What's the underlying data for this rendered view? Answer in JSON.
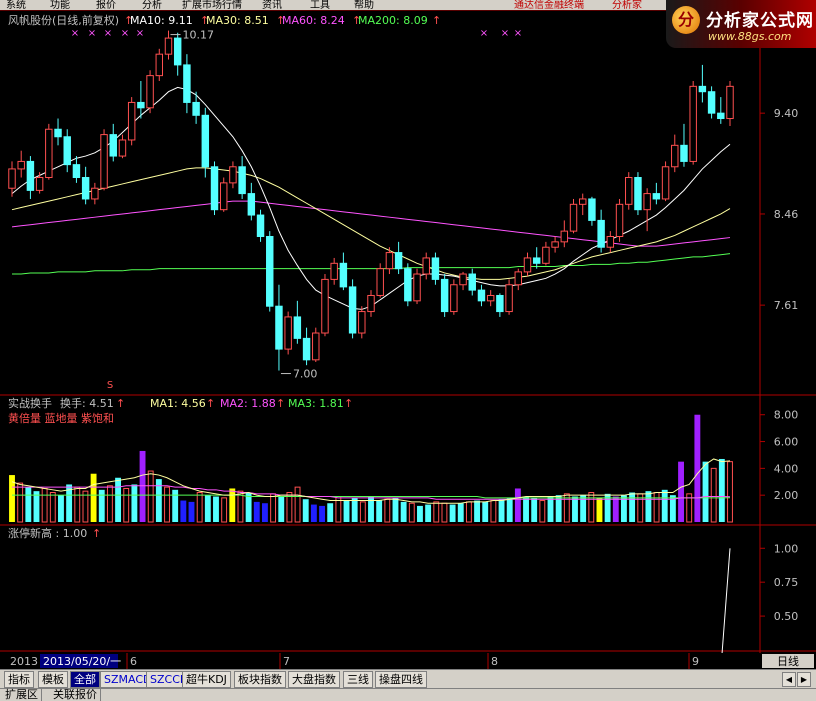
{
  "menu": {
    "items": [
      "系统",
      "功能",
      "报价",
      "分析",
      "扩展市场行情",
      "资讯",
      "工具",
      "帮助"
    ],
    "marquee": "通达信金融终端",
    "marquee2": "分析家"
  },
  "logo": {
    "name": "分析家公式网",
    "url": "www.88gs.com"
  },
  "main_header": {
    "stock": "风帆股份(日线,前复权)",
    "ma10": "MA10: 9.11",
    "ma30": "MA30: 8.51",
    "ma60": "MA60: 8.24",
    "ma200": "MA200: 8.09"
  },
  "turnover_header": {
    "name": "实战换手",
    "value": "换手: 4.51",
    "ma1": "MA1: 4.56",
    "ma2": "MA2: 1.88",
    "ma3": "MA3: 1.81",
    "legend": "黄倍量 蓝地量 紫饱和"
  },
  "limit_header": {
    "label": "涨停新高 : 1.00"
  },
  "annotations": {
    "high": "10.17",
    "low": "7.00",
    "marker": "S"
  },
  "date_axis": {
    "year": "2013",
    "cursor": "2013/05/20/一",
    "months": [
      "6",
      "7",
      "8",
      "9"
    ],
    "period": "日线"
  },
  "tabs": [
    "指标",
    "模板",
    "全部",
    "SZMACD",
    "SZCCI",
    "超牛KDJ",
    "板块指数",
    "大盘指数",
    "三线",
    "操盘四线"
  ],
  "status_tabs": [
    "扩展区",
    "关联报价"
  ],
  "colors": {
    "up": "#ff5050",
    "down": "#54ffff",
    "ma10": "#ffffff",
    "ma30": "#ffffa0",
    "ma60": "#ff54ff",
    "ma200": "#54ff54",
    "axis": "#b00000",
    "vol_yellow": "#ffff00",
    "vol_blue": "#2020ff",
    "vol_purple": "#a020ff"
  },
  "chart_data": [
    {
      "type": "candlestick",
      "ylim": [
        6.8,
        10.25
      ],
      "yticks": [
        7.61,
        8.46,
        9.4
      ],
      "ohlc": [
        [
          8.7,
          8.95,
          8.62,
          8.88
        ],
        [
          8.88,
          9.05,
          8.8,
          8.95
        ],
        [
          8.95,
          9.0,
          8.6,
          8.68
        ],
        [
          8.68,
          8.85,
          8.65,
          8.8
        ],
        [
          8.8,
          9.3,
          8.78,
          9.25
        ],
        [
          9.25,
          9.35,
          9.1,
          9.18
        ],
        [
          9.18,
          9.25,
          8.85,
          8.92
        ],
        [
          8.92,
          9.0,
          8.75,
          8.8
        ],
        [
          8.8,
          8.9,
          8.55,
          8.6
        ],
        [
          8.6,
          8.75,
          8.55,
          8.7
        ],
        [
          8.7,
          9.25,
          8.68,
          9.2
        ],
        [
          9.2,
          9.3,
          8.95,
          9.0
        ],
        [
          9.0,
          9.2,
          8.98,
          9.15
        ],
        [
          9.15,
          9.55,
          9.1,
          9.5
        ],
        [
          9.5,
          9.7,
          9.35,
          9.45
        ],
        [
          9.45,
          9.8,
          9.4,
          9.75
        ],
        [
          9.75,
          10.0,
          9.7,
          9.95
        ],
        [
          9.95,
          10.17,
          9.9,
          10.1
        ],
        [
          10.1,
          10.15,
          9.75,
          9.85
        ],
        [
          9.85,
          9.95,
          9.4,
          9.5
        ],
        [
          9.5,
          9.6,
          9.3,
          9.38
        ],
        [
          9.38,
          9.45,
          8.8,
          8.9
        ],
        [
          8.9,
          8.95,
          8.45,
          8.5
        ],
        [
          8.5,
          8.8,
          8.48,
          8.75
        ],
        [
          8.75,
          8.95,
          8.7,
          8.9
        ],
        [
          8.9,
          9.0,
          8.6,
          8.65
        ],
        [
          8.65,
          8.75,
          8.4,
          8.45
        ],
        [
          8.45,
          8.5,
          8.2,
          8.25
        ],
        [
          8.25,
          8.3,
          7.55,
          7.6
        ],
        [
          7.6,
          7.8,
          7.0,
          7.2
        ],
        [
          7.2,
          7.55,
          7.15,
          7.5
        ],
        [
          7.5,
          7.65,
          7.25,
          7.3
        ],
        [
          7.3,
          7.4,
          7.05,
          7.1
        ],
        [
          7.1,
          7.4,
          7.08,
          7.35
        ],
        [
          7.35,
          7.9,
          7.32,
          7.85
        ],
        [
          7.85,
          8.05,
          7.8,
          8.0
        ],
        [
          8.0,
          8.1,
          7.75,
          7.78
        ],
        [
          7.78,
          7.85,
          7.3,
          7.35
        ],
        [
          7.35,
          7.6,
          7.3,
          7.55
        ],
        [
          7.55,
          7.75,
          7.5,
          7.7
        ],
        [
          7.7,
          8.0,
          7.68,
          7.95
        ],
        [
          7.95,
          8.15,
          7.9,
          8.1
        ],
        [
          8.1,
          8.2,
          7.9,
          7.95
        ],
        [
          7.95,
          8.0,
          7.6,
          7.65
        ],
        [
          7.65,
          7.95,
          7.62,
          7.9
        ],
        [
          7.9,
          8.1,
          7.85,
          8.05
        ],
        [
          8.05,
          8.1,
          7.8,
          7.85
        ],
        [
          7.85,
          7.9,
          7.5,
          7.55
        ],
        [
          7.55,
          7.85,
          7.52,
          7.8
        ],
        [
          7.8,
          7.92,
          7.75,
          7.9
        ],
        [
          7.9,
          7.95,
          7.7,
          7.75
        ],
        [
          7.75,
          7.8,
          7.6,
          7.65
        ],
        [
          7.65,
          7.75,
          7.6,
          7.7
        ],
        [
          7.7,
          7.72,
          7.5,
          7.55
        ],
        [
          7.55,
          7.85,
          7.52,
          7.8
        ],
        [
          7.8,
          7.95,
          7.75,
          7.92
        ],
        [
          7.92,
          8.1,
          7.88,
          8.05
        ],
        [
          8.05,
          8.15,
          7.95,
          8.0
        ],
        [
          8.0,
          8.2,
          7.98,
          8.15
        ],
        [
          8.15,
          8.25,
          8.1,
          8.2
        ],
        [
          8.2,
          8.4,
          8.15,
          8.3
        ],
        [
          8.3,
          8.6,
          8.28,
          8.55
        ],
        [
          8.55,
          8.65,
          8.45,
          8.6
        ],
        [
          8.6,
          8.62,
          8.35,
          8.4
        ],
        [
          8.4,
          8.5,
          8.1,
          8.15
        ],
        [
          8.15,
          8.3,
          8.1,
          8.25
        ],
        [
          8.25,
          8.6,
          8.2,
          8.55
        ],
        [
          8.55,
          8.85,
          8.5,
          8.8
        ],
        [
          8.8,
          8.85,
          8.45,
          8.5
        ],
        [
          8.5,
          8.7,
          8.3,
          8.65
        ],
        [
          8.65,
          8.75,
          8.55,
          8.6
        ],
        [
          8.6,
          8.95,
          8.58,
          8.9
        ],
        [
          8.9,
          9.2,
          8.85,
          9.1
        ],
        [
          9.1,
          9.3,
          8.9,
          8.95
        ],
        [
          8.95,
          9.7,
          8.92,
          9.65
        ],
        [
          9.65,
          9.85,
          9.5,
          9.6
        ],
        [
          9.6,
          9.65,
          9.35,
          9.4
        ],
        [
          9.4,
          9.55,
          9.3,
          9.35
        ],
        [
          9.35,
          9.7,
          9.28,
          9.65
        ]
      ],
      "ma10": [
        8.65,
        8.72,
        8.78,
        8.82,
        8.86,
        8.9,
        8.94,
        8.98,
        9.0,
        9.03,
        9.08,
        9.14,
        9.22,
        9.3,
        9.38,
        9.45,
        9.52,
        9.6,
        9.64,
        9.62,
        9.57,
        9.48,
        9.38,
        9.28,
        9.18,
        9.05,
        8.9,
        8.72,
        8.52,
        8.3,
        8.12,
        7.98,
        7.85,
        7.75,
        7.7,
        7.66,
        7.62,
        7.58,
        7.57,
        7.6,
        7.66,
        7.72,
        7.78,
        7.84,
        7.88,
        7.9,
        7.9,
        7.89,
        7.88,
        7.86,
        7.84,
        7.82,
        7.8,
        7.79,
        7.79,
        7.8,
        7.82,
        7.84,
        7.86,
        7.9,
        7.95,
        8.02,
        8.08,
        8.14,
        8.18,
        8.22,
        8.26,
        8.3,
        8.35,
        8.4,
        8.45,
        8.52,
        8.6,
        8.68,
        8.78,
        8.88,
        8.96,
        9.04,
        9.11
      ],
      "ma30": [
        8.5,
        8.52,
        8.54,
        8.56,
        8.58,
        8.6,
        8.62,
        8.64,
        8.66,
        8.68,
        8.7,
        8.72,
        8.74,
        8.76,
        8.78,
        8.8,
        8.82,
        8.84,
        8.86,
        8.88,
        8.89,
        8.89,
        8.88,
        8.87,
        8.86,
        8.84,
        8.82,
        8.79,
        8.75,
        8.71,
        8.66,
        8.61,
        8.56,
        8.51,
        8.46,
        8.41,
        8.36,
        8.31,
        8.26,
        8.21,
        8.16,
        8.12,
        8.08,
        8.04,
        8.0,
        7.97,
        7.94,
        7.91,
        7.89,
        7.87,
        7.86,
        7.85,
        7.85,
        7.85,
        7.86,
        7.87,
        7.88,
        7.9,
        7.92,
        7.94,
        7.97,
        8.0,
        8.03,
        8.06,
        8.08,
        8.1,
        8.12,
        8.14,
        8.16,
        8.18,
        8.2,
        8.23,
        8.26,
        8.3,
        8.34,
        8.38,
        8.42,
        8.46,
        8.51
      ],
      "ma60": [
        8.34,
        8.35,
        8.36,
        8.37,
        8.38,
        8.39,
        8.4,
        8.41,
        8.42,
        8.43,
        8.44,
        8.45,
        8.46,
        8.47,
        8.48,
        8.49,
        8.5,
        8.51,
        8.52,
        8.53,
        8.54,
        8.55,
        8.56,
        8.57,
        8.58,
        8.58,
        8.58,
        8.57,
        8.56,
        8.55,
        8.54,
        8.53,
        8.52,
        8.51,
        8.5,
        8.49,
        8.48,
        8.47,
        8.46,
        8.45,
        8.44,
        8.43,
        8.42,
        8.41,
        8.4,
        8.39,
        8.38,
        8.37,
        8.36,
        8.35,
        8.34,
        8.33,
        8.32,
        8.31,
        8.3,
        8.29,
        8.28,
        8.27,
        8.26,
        8.25,
        8.24,
        8.23,
        8.22,
        8.21,
        8.2,
        8.19,
        8.18,
        8.17,
        8.16,
        8.16,
        8.16,
        8.17,
        8.18,
        8.19,
        8.2,
        8.21,
        8.22,
        8.23,
        8.24
      ],
      "ma200": [
        7.9,
        7.9,
        7.91,
        7.91,
        7.91,
        7.92,
        7.92,
        7.92,
        7.92,
        7.93,
        7.93,
        7.93,
        7.93,
        7.94,
        7.94,
        7.94,
        7.95,
        7.95,
        7.95,
        7.95,
        7.95,
        7.95,
        7.95,
        7.95,
        7.95,
        7.95,
        7.95,
        7.95,
        7.95,
        7.95,
        7.95,
        7.95,
        7.95,
        7.95,
        7.95,
        7.95,
        7.95,
        7.95,
        7.95,
        7.95,
        7.95,
        7.95,
        7.95,
        7.96,
        7.96,
        7.96,
        7.96,
        7.96,
        7.96,
        7.96,
        7.96,
        7.96,
        7.96,
        7.96,
        7.96,
        7.97,
        7.97,
        7.97,
        7.97,
        7.97,
        7.98,
        7.98,
        7.98,
        7.99,
        7.99,
        7.99,
        8.0,
        8.0,
        8.01,
        8.01,
        8.02,
        8.03,
        8.04,
        8.05,
        8.06,
        8.06,
        8.07,
        8.08,
        8.09
      ]
    },
    {
      "type": "bar",
      "ylim": [
        0,
        8.8
      ],
      "yticks": [
        2.0,
        4.0,
        6.0,
        8.0
      ],
      "values": [
        3.5,
        2.9,
        2.6,
        2.3,
        2.5,
        2.2,
        2.0,
        2.8,
        2.6,
        2.3,
        3.6,
        2.4,
        2.7,
        3.3,
        2.5,
        2.8,
        5.3,
        3.8,
        3.2,
        2.6,
        2.4,
        1.6,
        1.5,
        2.2,
        2.0,
        1.9,
        1.8,
        2.5,
        2.3,
        2.2,
        1.5,
        1.4,
        2.1,
        1.9,
        2.2,
        2.6,
        1.7,
        1.3,
        1.2,
        1.4,
        1.9,
        1.6,
        1.8,
        1.5,
        1.9,
        1.6,
        1.7,
        1.8,
        1.5,
        1.4,
        1.2,
        1.3,
        1.5,
        1.4,
        1.3,
        1.4,
        1.5,
        1.6,
        1.5,
        1.6,
        1.7,
        1.8,
        2.5,
        1.9,
        1.8,
        1.6,
        1.9,
        2.0,
        2.1,
        1.9,
        2.0,
        2.2,
        1.8,
        2.1,
        1.9,
        2.0,
        2.2,
        2.1,
        2.3,
        2.2,
        2.4,
        2.0,
        4.5,
        2.1,
        8.0,
        4.5,
        4.0,
        4.7,
        4.5
      ],
      "ma1": [
        3.0,
        2.8,
        2.7,
        2.6,
        2.5,
        2.4,
        2.3,
        2.4,
        2.5,
        2.5,
        2.8,
        2.9,
        3.0,
        3.1,
        3.2,
        3.3,
        3.5,
        3.6,
        3.5,
        3.3,
        3.0,
        2.7,
        2.5,
        2.3,
        2.2,
        2.1,
        2.0,
        2.0,
        2.1,
        2.2,
        2.0,
        1.9,
        1.9,
        2.0,
        2.0,
        2.0,
        1.9,
        1.8,
        1.7,
        1.6,
        1.6,
        1.6,
        1.6,
        1.6,
        1.6,
        1.6,
        1.7,
        1.7,
        1.6,
        1.5,
        1.5,
        1.4,
        1.4,
        1.4,
        1.4,
        1.4,
        1.5,
        1.5,
        1.5,
        1.6,
        1.6,
        1.7,
        1.8,
        1.9,
        1.9,
        1.9,
        1.9,
        1.9,
        2.0,
        2.0,
        2.0,
        2.0,
        2.0,
        2.0,
        2.0,
        2.0,
        2.1,
        2.1,
        2.1,
        2.2,
        2.2,
        2.2,
        2.6,
        2.8,
        3.6,
        4.3,
        4.7,
        4.5,
        4.56
      ],
      "ma2": [
        2.6,
        2.6,
        2.6,
        2.6,
        2.6,
        2.6,
        2.6,
        2.6,
        2.6,
        2.6,
        2.6,
        2.6,
        2.6,
        2.6,
        2.7,
        2.7,
        2.7,
        2.7,
        2.7,
        2.7,
        2.6,
        2.6,
        2.5,
        2.5,
        2.4,
        2.4,
        2.3,
        2.3,
        2.2,
        2.2,
        2.1,
        2.1,
        2.1,
        2.0,
        2.0,
        2.0,
        1.9,
        1.9,
        1.9,
        1.9,
        1.8,
        1.8,
        1.8,
        1.8,
        1.8,
        1.8,
        1.8,
        1.8,
        1.8,
        1.8,
        1.8,
        1.8,
        1.7,
        1.7,
        1.7,
        1.7,
        1.7,
        1.7,
        1.7,
        1.7,
        1.7,
        1.7,
        1.7,
        1.7,
        1.7,
        1.7,
        1.7,
        1.7,
        1.7,
        1.7,
        1.7,
        1.7,
        1.7,
        1.7,
        1.7,
        1.7,
        1.7,
        1.7,
        1.7,
        1.7,
        1.7,
        1.7,
        1.8,
        1.8,
        1.8,
        1.9,
        1.9,
        1.9,
        1.88
      ],
      "ma3": [
        2.0,
        2.0,
        2.0,
        2.0,
        2.0,
        2.0,
        2.0,
        2.0,
        2.0,
        2.0,
        2.0,
        2.0,
        2.0,
        2.0,
        2.0,
        2.0,
        2.0,
        2.0,
        2.0,
        2.0,
        2.0,
        2.0,
        2.0,
        2.0,
        2.0,
        2.0,
        2.0,
        2.0,
        2.0,
        1.9,
        1.9,
        1.9,
        1.9,
        1.9,
        1.9,
        1.9,
        1.9,
        1.9,
        1.9,
        1.9,
        1.9,
        1.9,
        1.9,
        1.9,
        1.9,
        1.9,
        1.9,
        1.9,
        1.9,
        1.9,
        1.9,
        1.9,
        1.9,
        1.9,
        1.9,
        1.9,
        1.9,
        1.9,
        1.8,
        1.8,
        1.8,
        1.8,
        1.8,
        1.8,
        1.8,
        1.8,
        1.8,
        1.8,
        1.8,
        1.8,
        1.8,
        1.8,
        1.8,
        1.8,
        1.8,
        1.8,
        1.8,
        1.8,
        1.8,
        1.8,
        1.8,
        1.8,
        1.8,
        1.8,
        1.8,
        1.8,
        1.8,
        1.8,
        1.81
      ],
      "color_flags": [
        "yellow",
        "up",
        "down",
        "down",
        "up",
        "up",
        "down",
        "down",
        "up",
        "up",
        "yellow",
        "down",
        "up",
        "down",
        "up",
        "down",
        "purple",
        "up",
        "down",
        "up",
        "down",
        "blue",
        "blue",
        "up",
        "down",
        "down",
        "up",
        "yellow",
        "up",
        "down",
        "blue",
        "blue",
        "up",
        "down",
        "up",
        "up",
        "down",
        "blue",
        "blue",
        "down",
        "up",
        "down",
        "down",
        "up",
        "down",
        "down",
        "up",
        "down",
        "down",
        "up",
        "down",
        "down",
        "up",
        "up",
        "down",
        "down",
        "up",
        "down",
        "down",
        "up",
        "down",
        "down",
        "purple",
        "down",
        "down",
        "up",
        "down",
        "down",
        "up",
        "down",
        "down",
        "up",
        "yellow",
        "down",
        "purple",
        "down",
        "down",
        "up",
        "down",
        "up",
        "down",
        "down",
        "purple",
        "up",
        "purple",
        "down",
        "up",
        "down",
        "up"
      ]
    },
    {
      "type": "line",
      "ylim": [
        0.25,
        1.12
      ],
      "yticks": [
        0.5,
        0.75,
        1.0
      ],
      "values": [
        0,
        0,
        0,
        0,
        0,
        0,
        0,
        0,
        1.0
      ]
    }
  ]
}
